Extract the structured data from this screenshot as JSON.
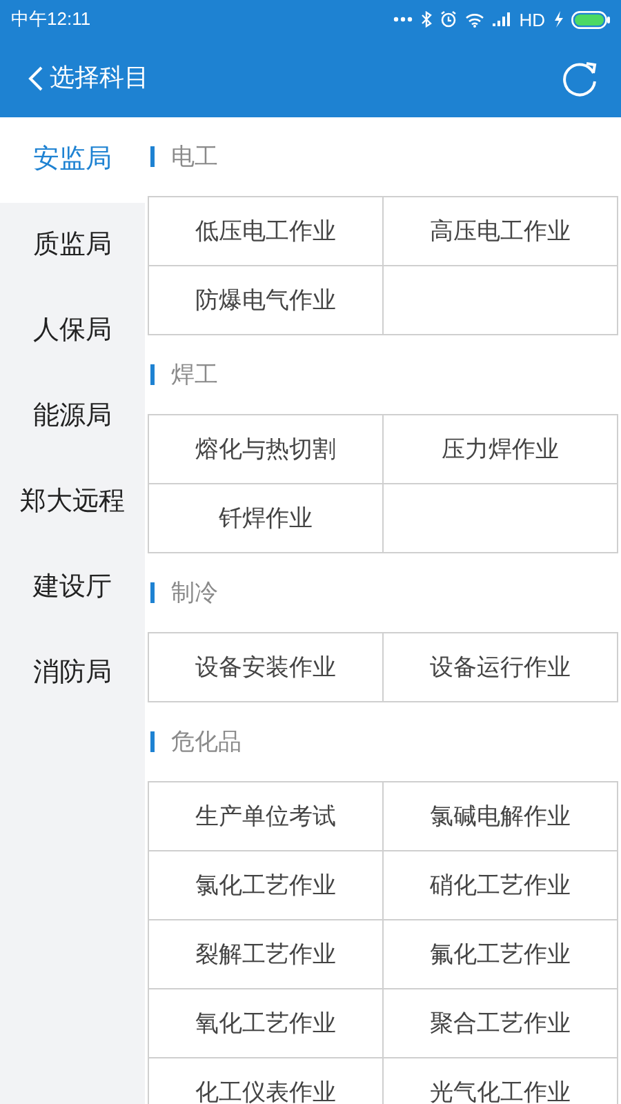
{
  "status_bar": {
    "time": "中午12:11",
    "network": "HD"
  },
  "header": {
    "title": "选择科目"
  },
  "sidebar": {
    "items": [
      {
        "label": "安监局",
        "selected": true
      },
      {
        "label": "质监局",
        "selected": false
      },
      {
        "label": "人保局",
        "selected": false
      },
      {
        "label": "能源局",
        "selected": false
      },
      {
        "label": "郑大远程",
        "selected": false
      },
      {
        "label": "建设厅",
        "selected": false
      },
      {
        "label": "消防局",
        "selected": false
      }
    ]
  },
  "sections": [
    {
      "title": "电工",
      "items": [
        "低压电工作业",
        "高压电工作业",
        "防爆电气作业"
      ]
    },
    {
      "title": "焊工",
      "items": [
        "熔化与热切割",
        "压力焊作业",
        "钎焊作业"
      ]
    },
    {
      "title": "制冷",
      "items": [
        "设备安装作业",
        "设备运行作业"
      ]
    },
    {
      "title": "危化品",
      "items": [
        "生产单位考试",
        "氯碱电解作业",
        "氯化工艺作业",
        "硝化工艺作业",
        "裂解工艺作业",
        "氟化工艺作业",
        "氧化工艺作业",
        "聚合工艺作业",
        "化工仪表作业",
        "光气化工作业"
      ]
    }
  ]
}
